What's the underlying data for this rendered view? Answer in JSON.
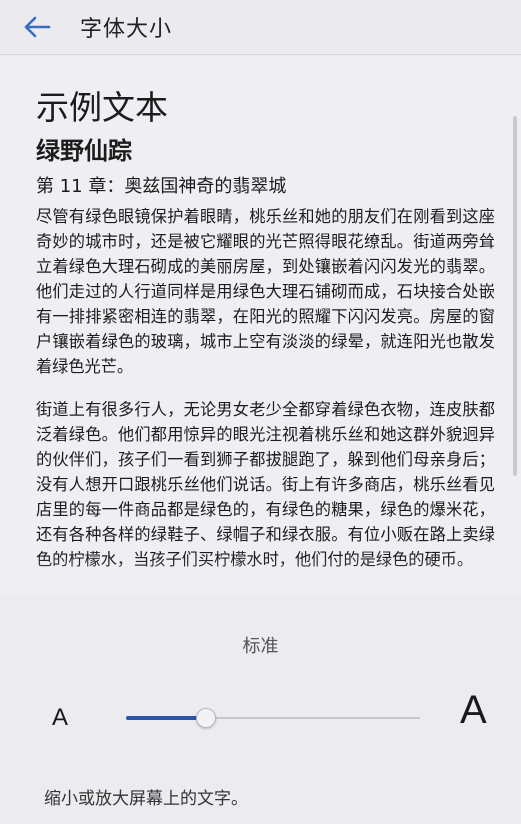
{
  "header": {
    "back_icon": "arrow-left-icon",
    "title": "字体大小"
  },
  "preview": {
    "heading": "示例文本",
    "book_title": "绿野仙踪",
    "chapter_title": "第 11 章：奥兹国神奇的翡翠城",
    "paragraphs": [
      "尽管有绿色眼镜保护着眼睛，桃乐丝和她的朋友们在刚看到这座奇妙的城市时，还是被它耀眼的光芒照得眼花缭乱。街道两旁耸立着绿色大理石砌成的美丽房屋，到处镶嵌着闪闪发光的翡翠。他们走过的人行道同样是用绿色大理石铺砌而成，石块接合处嵌有一排排紧密相连的翡翠，在阳光的照耀下闪闪发亮。房屋的窗户镶嵌着绿色的玻璃，城市上空有淡淡的绿晕，就连阳光也散发着绿色光芒。",
      "街道上有很多行人，无论男女老少全都穿着绿色衣物，连皮肤都泛着绿色。他们都用惊异的眼光注视着桃乐丝和她这群外貌迥异的伙伴们，孩子们一看到狮子都拔腿跑了，躲到他们母亲身后；没有人想开口跟桃乐丝他们说话。街上有许多商店，桃乐丝看见店里的每一件商品都是绿色的，有绿色的糖果，绿色的爆米花，还有各种各样的绿鞋子、绿帽子和绿衣服。有位小贩在路上卖绿色的柠檬水，当孩子们买柠檬水时，他们付的是绿色的硬币。"
    ]
  },
  "font_size": {
    "level_label": "标准",
    "small_label": "A",
    "large_label": "A",
    "slider_level": 0.27,
    "hint": "缩小或放大屏幕上的文字。"
  },
  "colors": {
    "accent": "#2d54a8",
    "back_arrow": "#3a6cc6"
  }
}
